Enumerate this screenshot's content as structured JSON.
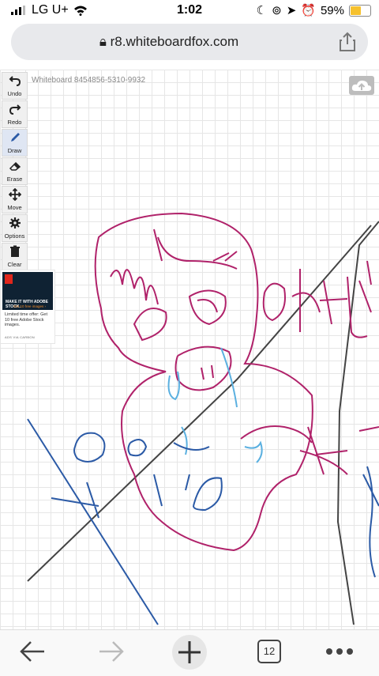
{
  "status": {
    "carrier": "LG U+",
    "time": "1:02",
    "battery": "59%",
    "battery_level": 0.59
  },
  "browser": {
    "url": "r8.whiteboardfox.com",
    "tabs_count": "12"
  },
  "whiteboard": {
    "title": "Whiteboard 8454856-5310-9932"
  },
  "toolbar": {
    "undo": "Undo",
    "redo": "Redo",
    "draw": "Draw",
    "erase": "Erase",
    "move": "Move",
    "options": "Options",
    "clear": "Clear"
  },
  "ad": {
    "headline": "MAKE IT WITH ADOBE STOCK.",
    "cta": "Get 10 free images ›",
    "text": "Limited time offer: Get 10 free Adobe Stock images.",
    "footer": "ADS VIA CARBON"
  },
  "colors": {
    "magenta": "#b0226a",
    "dark_blue": "#2b5aa6",
    "light_blue": "#5bb0e0",
    "dark_gray": "#444444",
    "accent": "#2b5aa6"
  }
}
